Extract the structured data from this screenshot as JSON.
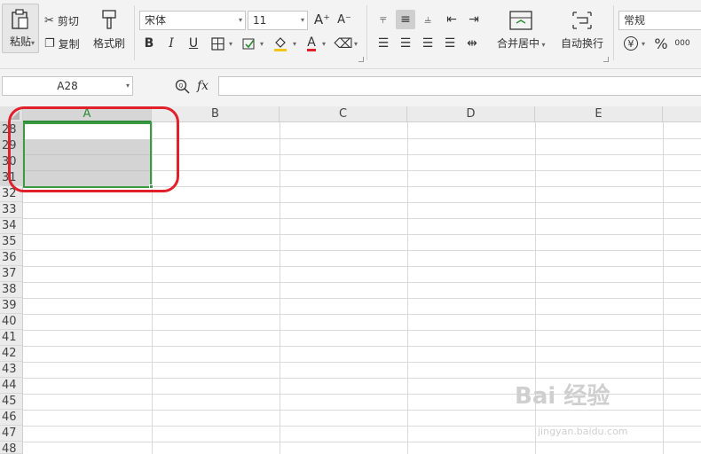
{
  "ribbon": {
    "paste_label": "粘贴",
    "cut_label": "剪切",
    "copy_label": "复制",
    "format_painter_label": "格式刷",
    "font_name": "宋体",
    "font_size": "11",
    "merge_center_label": "合并居中",
    "wrap_text_label": "自动换行",
    "number_format": "常规",
    "increase_font_glyph": "A⁺",
    "decrease_font_glyph": "A⁻",
    "bold_glyph": "B",
    "italic_glyph": "I",
    "underline_glyph": "U",
    "font_color_glyph": "A",
    "percent_glyph": "%",
    "currency_glyph": "¥",
    "thousands_glyph": "000"
  },
  "formula_bar": {
    "name_box": "A28",
    "fx_label": "fx",
    "formula_value": ""
  },
  "sheet": {
    "columns": [
      "A",
      "B",
      "C",
      "D",
      "E"
    ],
    "rows": [
      "28",
      "29",
      "30",
      "31",
      "32",
      "33",
      "34",
      "35",
      "36",
      "37",
      "38",
      "39",
      "40",
      "41",
      "42",
      "43",
      "44",
      "45",
      "46",
      "47",
      "48"
    ],
    "selected_column": "A",
    "selected_rows": [
      "28",
      "29",
      "30",
      "31"
    ]
  },
  "watermark": {
    "text": "Bai 经验",
    "url": "jingyan.baidu.com"
  },
  "colors": {
    "selection_border": "#3a9a45",
    "annotation": "#e0202a",
    "ribbon_bg": "#f3f3f3"
  }
}
